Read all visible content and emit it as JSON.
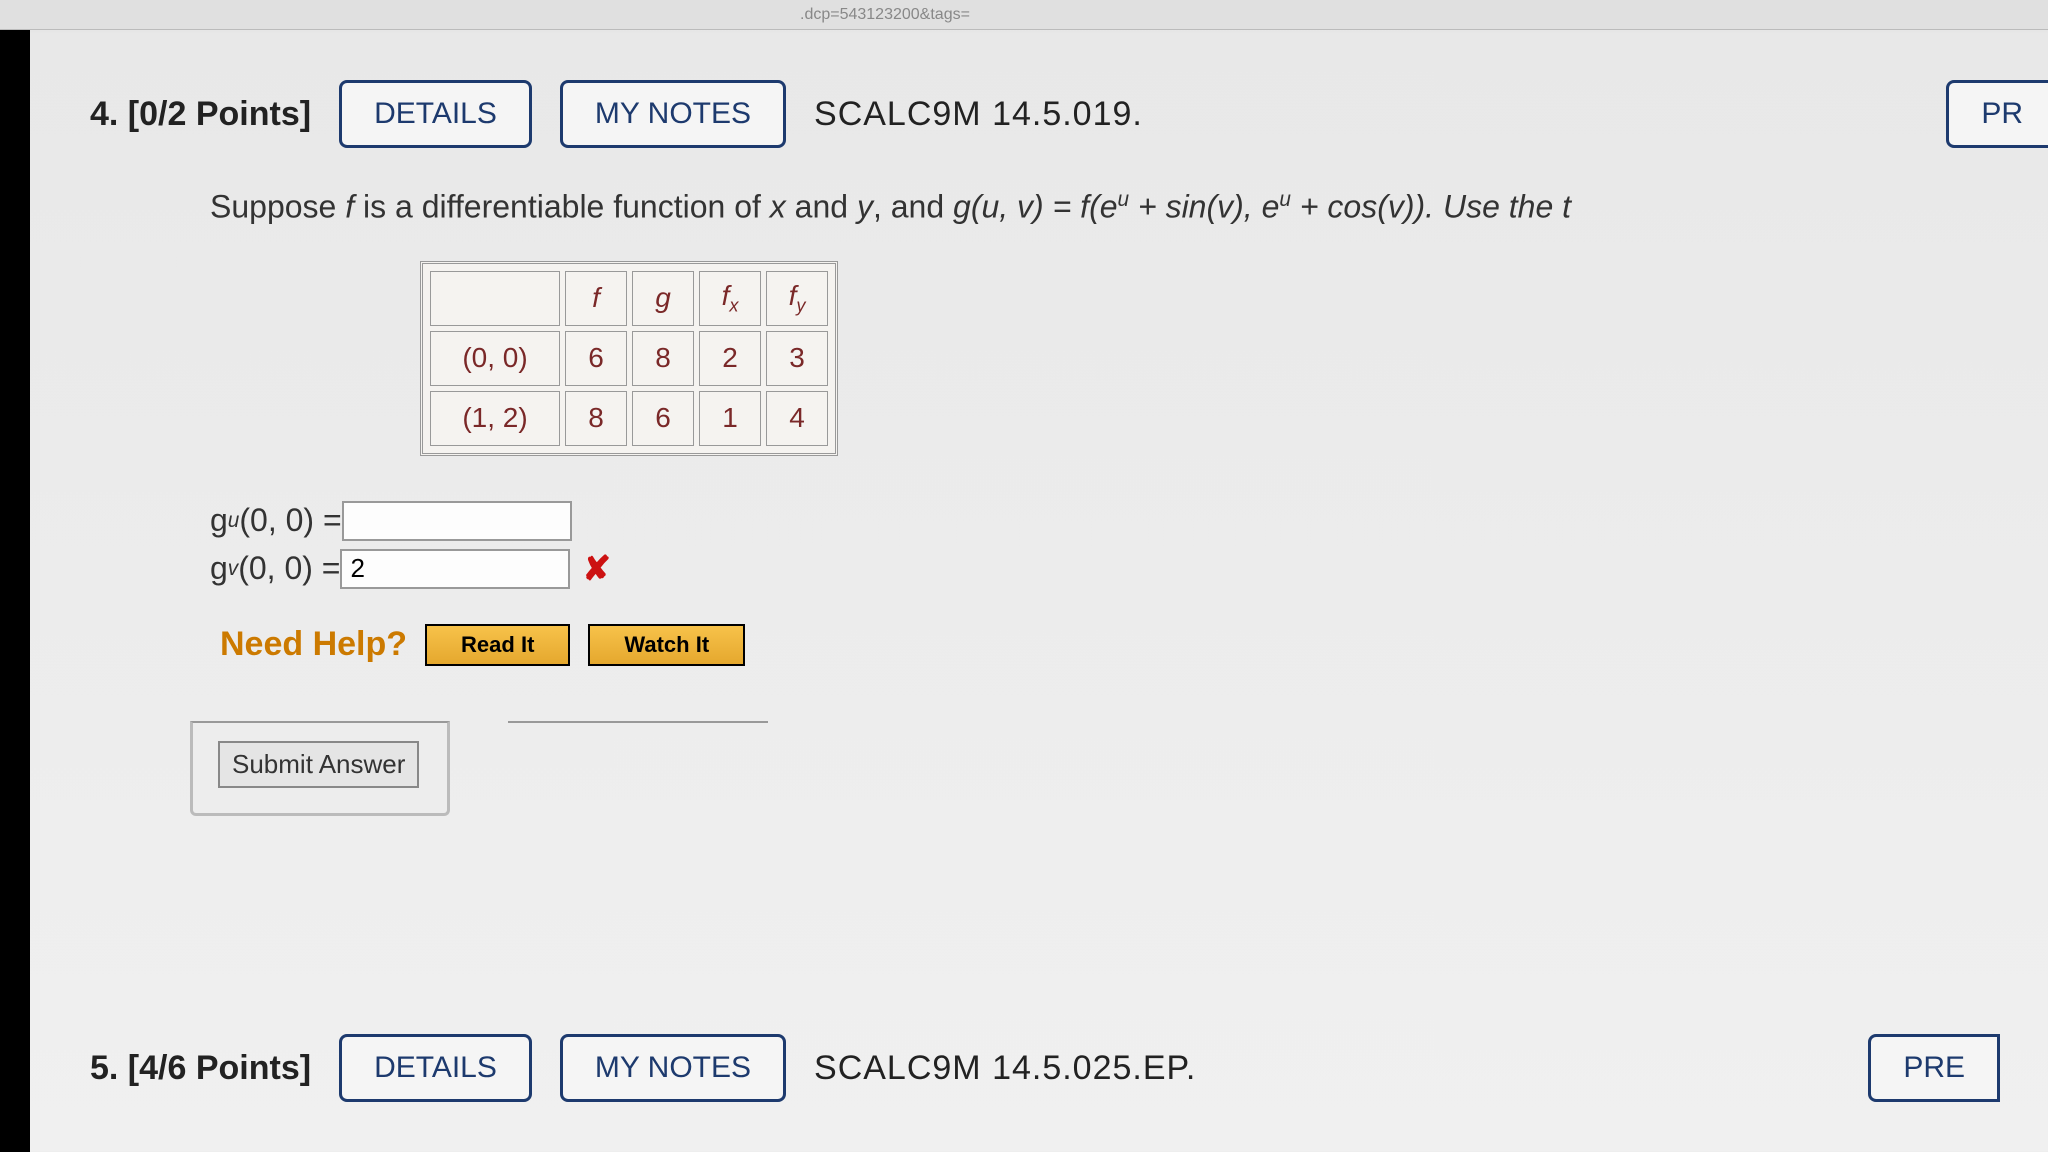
{
  "url_fragment": ".dcp=543123200&tags=",
  "q4": {
    "number_points": "4.  [0/2 Points]",
    "details": "DETAILS",
    "mynotes": "MY NOTES",
    "code": "SCALC9M 14.5.019.",
    "pr": "PR"
  },
  "problem_text": {
    "prefix": "Suppose ",
    "f": "f",
    "mid1": " is a differentiable function of ",
    "x": "x",
    "and": " and ",
    "y": "y",
    "mid2": ", and ",
    "g": "g",
    "paren": "(u, v) = f(e",
    "u1": "u",
    "plus_sin": " + sin(v), e",
    "u2": "u",
    "plus_cos": " + cos(v)). Use the t"
  },
  "table": {
    "h_f": "f",
    "h_g": "g",
    "h_fx": "f",
    "h_fx_sub": "x",
    "h_fy": "f",
    "h_fy_sub": "y",
    "r1p": "(0, 0)",
    "r1f": "6",
    "r1g": "8",
    "r1fx": "2",
    "r1fy": "3",
    "r2p": "(1, 2)",
    "r2f": "8",
    "r2g": "6",
    "r2fx": "1",
    "r2fy": "4"
  },
  "answers": {
    "gu_label_g": "g",
    "gu_label_sub": "u",
    "gu_label_rest": "(0, 0) = ",
    "gu_value": "",
    "gv_label_g": "g",
    "gv_label_sub": "v",
    "gv_label_rest": "(0, 0) = ",
    "gv_value": "2"
  },
  "help": {
    "label": "Need Help?",
    "read": "Read It",
    "watch": "Watch It"
  },
  "submit": "Submit Answer",
  "q5": {
    "number_points": "5.  [4/6 Points]",
    "details": "DETAILS",
    "mynotes": "MY NOTES",
    "code": "SCALC9M 14.5.025.EP.",
    "pre": "PRE"
  }
}
